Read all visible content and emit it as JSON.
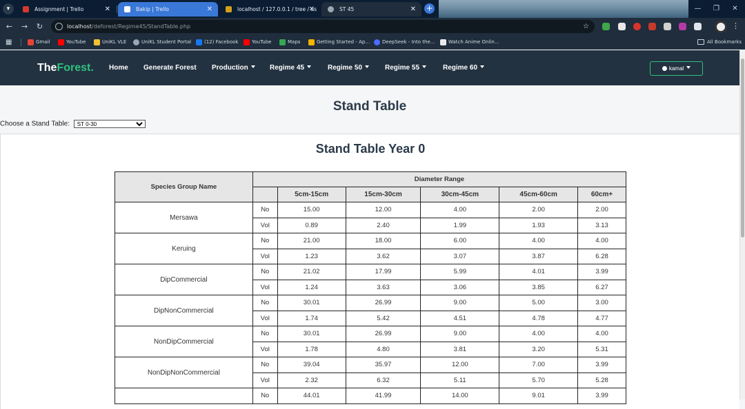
{
  "browser": {
    "tabs": [
      {
        "title": "Assignment | Trello",
        "color": "#d33a2c"
      },
      {
        "title": "Bakip | Trello",
        "color": "#2d7be5"
      },
      {
        "title": "localhost / 127.0.0.1 / tree / us",
        "color": "#d4a017"
      },
      {
        "title": "ST 45",
        "color": "#9aa7b3"
      }
    ],
    "url_host": "localhost",
    "url_path": "/deforest/Regime45/StandTable.php",
    "bookmarks": [
      {
        "label": "Gmail",
        "color": "#ea4335"
      },
      {
        "label": "YouTube",
        "color": "#ff0000"
      },
      {
        "label": "UniKL VLE",
        "color": "#f1c232"
      },
      {
        "label": "UniKL Student Portal",
        "color": "#9aa7b3"
      },
      {
        "label": "(12) Facebook",
        "color": "#1877f2"
      },
      {
        "label": "YouTube",
        "color": "#ff0000"
      },
      {
        "label": "Maps",
        "color": "#34a853"
      },
      {
        "label": "Getting Started - Ap...",
        "color": "#f4b400"
      },
      {
        "label": "DeepSeek - Into the...",
        "color": "#4d6bfe"
      },
      {
        "label": "Watch Anime Onlin...",
        "color": "#e8eaed"
      }
    ],
    "all_bookmarks": "All Bookmarks"
  },
  "nav": {
    "brand_prefix": "The",
    "brand_suffix": "Forest.",
    "items": [
      "Home",
      "Generate Forest",
      "Production",
      "Regime 45",
      "Regime 50",
      "Regime 55",
      "Regime 60"
    ],
    "user": "kamal"
  },
  "page": {
    "title": "Stand Table",
    "chooser_label": "Choose a Stand Table:",
    "chooser_value": "ST 0-30",
    "card_title": "Stand Table Year 0"
  },
  "table": {
    "species_header": "Species Group Name",
    "range_header": "Diameter Range",
    "columns": [
      "5cm-15cm",
      "15cm-30cm",
      "30cm-45cm",
      "45cm-60cm",
      "60cm+"
    ],
    "groups": [
      {
        "name": "Mersawa",
        "no": [
          "15.00",
          "12.00",
          "4.00",
          "2.00",
          "2.00"
        ],
        "vol": [
          "0.89",
          "2.40",
          "1.99",
          "1.93",
          "3.13"
        ]
      },
      {
        "name": "Keruing",
        "no": [
          "21.00",
          "18.00",
          "6.00",
          "4.00",
          "4.00"
        ],
        "vol": [
          "1.23",
          "3.62",
          "3.07",
          "3.87",
          "6.28"
        ]
      },
      {
        "name": "DipCommercial",
        "no": [
          "21.02",
          "17.99",
          "5.99",
          "4.01",
          "3.99"
        ],
        "vol": [
          "1.24",
          "3.63",
          "3.06",
          "3.85",
          "6.27"
        ]
      },
      {
        "name": "DipNonCommercial",
        "no": [
          "30.01",
          "26.99",
          "9.00",
          "5.00",
          "3.00"
        ],
        "vol": [
          "1.74",
          "5.42",
          "4.51",
          "4.78",
          "4.77"
        ]
      },
      {
        "name": "NonDipCommercial",
        "no": [
          "30.01",
          "26.99",
          "9.00",
          "4.00",
          "4.00"
        ],
        "vol": [
          "1.78",
          "4.80",
          "3.81",
          "3.20",
          "5.31"
        ]
      },
      {
        "name": "NonDipNonCommercial",
        "no": [
          "39.04",
          "35.97",
          "12.00",
          "7.00",
          "3.99"
        ],
        "vol": [
          "2.32",
          "6.32",
          "5.11",
          "5.70",
          "5.28"
        ]
      },
      {
        "name": "",
        "no": [
          "44.01",
          "41.99",
          "14.00",
          "9.01",
          "3.99"
        ],
        "vol": []
      }
    ],
    "no_label": "No",
    "vol_label": "Vol"
  }
}
